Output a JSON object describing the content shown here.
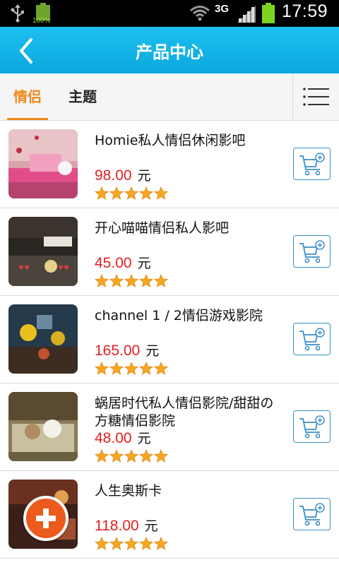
{
  "status_bar": {
    "battery_small_label": "100%",
    "network_type": "3G",
    "time": "17:59"
  },
  "header": {
    "title": "产品中心",
    "back_icon": "chevron-left-icon"
  },
  "tabs": [
    {
      "label": "情侣",
      "active": true
    },
    {
      "label": "主题",
      "active": false
    }
  ],
  "menu_icon": "hamburger-menu-icon",
  "products": [
    {
      "name": "Homie私人情侣休闲影吧",
      "price": "98.00",
      "unit": "元",
      "rating": 5
    },
    {
      "name": "开心喵喵情侣私人影吧",
      "price": "45.00",
      "unit": "元",
      "rating": 5
    },
    {
      "name": "channel 1 / 2情侣游戏影院",
      "price": "165.00",
      "unit": "元",
      "rating": 5
    },
    {
      "name": "蜗居时代私人情侣影院/甜甜の方糖情侣影院",
      "price": "48.00",
      "unit": "元",
      "rating": 5
    },
    {
      "name": "人生奥斯卡",
      "price": "118.00",
      "unit": "元",
      "rating": 5
    }
  ],
  "colors": {
    "header_blue": "#09a8df",
    "tab_active": "#f08a1e",
    "price_red": "#e02020",
    "cart_blue": "#3a8fc8",
    "fab_orange": "#ec5a1c",
    "star_orange": "#f5a623"
  }
}
